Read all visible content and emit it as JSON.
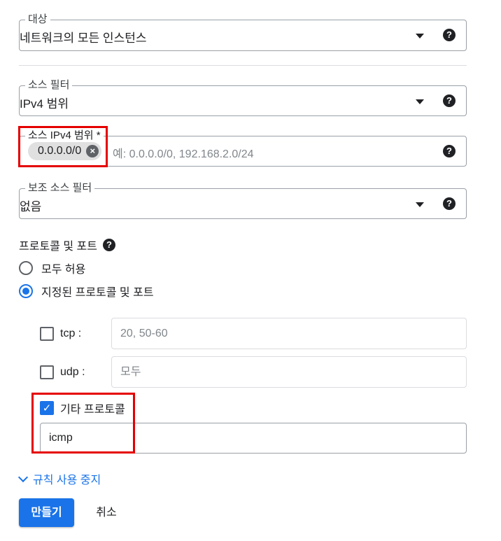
{
  "target": {
    "label": "대상",
    "value": "네트워크의 모든 인스턴스"
  },
  "source_filter": {
    "label": "소스 필터",
    "value": "IPv4 범위"
  },
  "source_ipv4_range": {
    "label": "소스 IPv4 범위 *",
    "chip": "0.0.0.0/0",
    "placeholder": "예: 0.0.0.0/0, 192.168.2.0/24"
  },
  "secondary_source_filter": {
    "label": "보조 소스 필터",
    "value": "없음"
  },
  "protocols_ports": {
    "title": "프로토콜 및 포트",
    "options": [
      {
        "label": "모두 허용",
        "selected": false
      },
      {
        "label": "지정된 프로토콜 및 포트",
        "selected": true
      }
    ],
    "tcp": {
      "label": "tcp :",
      "checked": false,
      "placeholder": "20, 50-60"
    },
    "udp": {
      "label": "udp :",
      "checked": false,
      "placeholder": "모두"
    },
    "other": {
      "label": "기타 프로토콜",
      "checked": true,
      "value": "icmp"
    }
  },
  "disable_rule_label": "규칙 사용 중지",
  "buttons": {
    "create": "만들기",
    "cancel": "취소"
  },
  "colors": {
    "accent": "#1a73e8",
    "highlight": "#e50000"
  },
  "icons": {
    "help": "help-icon",
    "dropdown": "dropdown-arrow-icon",
    "chip_remove": "cancel-circle-icon",
    "check": "check-icon",
    "chevron": "chevron-down-icon"
  }
}
